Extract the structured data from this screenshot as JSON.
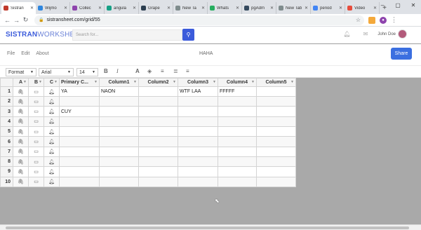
{
  "browser": {
    "tabs": [
      {
        "label": "Sistran",
        "color": "#c0392b",
        "active": true
      },
      {
        "label": "Wijmo",
        "color": "#2e86de"
      },
      {
        "label": "Collec",
        "color": "#8e44ad"
      },
      {
        "label": "angula",
        "color": "#16a085"
      },
      {
        "label": "Grape",
        "color": "#2c3e50"
      },
      {
        "label": "New Ta",
        "color": "#7f8c8d"
      },
      {
        "label": "Whats",
        "color": "#27ae60"
      },
      {
        "label": "pgAdm",
        "color": "#34495e"
      },
      {
        "label": "New Tab",
        "color": "#7f8c8d"
      },
      {
        "label": "period",
        "color": "#4285f4"
      },
      {
        "label": "Video",
        "color": "#e74c3c"
      }
    ],
    "new_tab": "+",
    "url": "sistransheet.com/grid/55"
  },
  "app": {
    "logo_bold": "SISTRAN",
    "logo_light": "WORKSHEET",
    "search_placeholder": "Search for...",
    "user_name": "John Doe"
  },
  "menubar": {
    "items": [
      "File",
      "Edit",
      "About"
    ],
    "doc_title": "HAHA",
    "share_label": "Share"
  },
  "toolbar": {
    "format_label": "Format",
    "font_family": "Arial",
    "font_size": "14",
    "bold": "B",
    "italic": "I",
    "text_color": "A"
  },
  "grid": {
    "columns": [
      "A",
      "B",
      "C",
      "Primary C...",
      "Column1",
      "Column2",
      "Column3",
      "Column4",
      "Column5"
    ],
    "rows": [
      [
        "1",
        "YA",
        "NAON",
        "",
        "WTF LAA",
        "FFFFF",
        ""
      ],
      [
        "2",
        "",
        "",
        "",
        "",
        "",
        ""
      ],
      [
        "3",
        "CUY",
        "",
        "",
        "",
        "",
        ""
      ],
      [
        "4",
        "",
        "",
        "",
        "",
        "",
        ""
      ],
      [
        "5",
        "",
        "",
        "",
        "",
        "",
        ""
      ],
      [
        "6",
        "",
        "",
        "",
        "",
        "",
        ""
      ],
      [
        "7",
        "",
        "",
        "",
        "",
        "",
        ""
      ],
      [
        "8",
        "",
        "",
        "",
        "",
        "",
        ""
      ],
      [
        "9",
        "",
        "",
        "",
        "",
        "",
        ""
      ],
      [
        "10",
        "",
        "",
        "",
        "",
        "",
        ""
      ]
    ]
  }
}
